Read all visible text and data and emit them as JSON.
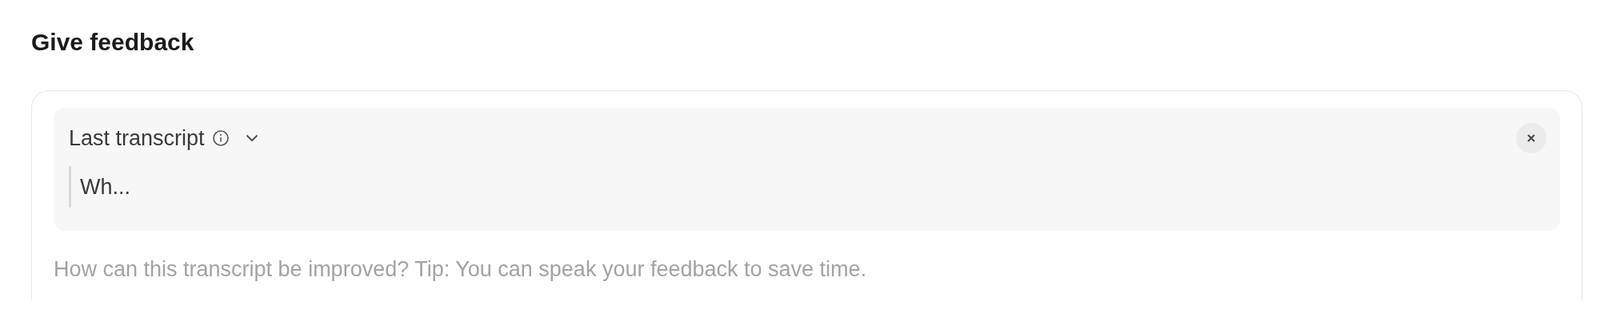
{
  "title": "Give feedback",
  "transcript_panel": {
    "label": "Last transcript",
    "text": "Wh..."
  },
  "feedback_field": {
    "placeholder": "How can this transcript be improved? Tip: You can speak your feedback to save time."
  }
}
